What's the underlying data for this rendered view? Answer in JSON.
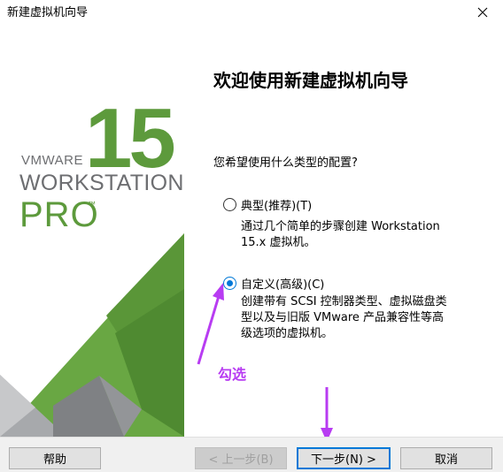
{
  "window": {
    "title": "新建虚拟机向导"
  },
  "logo": {
    "number": "15",
    "brand": "VMWARE",
    "product": "WORKSTATION",
    "edition": "PRO",
    "trademark": "™"
  },
  "main": {
    "heading": "欢迎使用新建虚拟机向导",
    "question": "您希望使用什么类型的配置?",
    "options": [
      {
        "label": "典型(推荐)(T)",
        "description_lines": [
          "通过几个简单的步骤创建 Workstation",
          "15.x 虚拟机。"
        ],
        "selected": false
      },
      {
        "label": "自定义(高级)(C)",
        "description_lines": [
          "创建带有 SCSI 控制器类型、虚拟磁盘类",
          "型以及与旧版 VMware 产品兼容性等高",
          "级选项的虚拟机。"
        ],
        "selected": true
      }
    ]
  },
  "annotation": {
    "text": "勾选",
    "color": "#b83cf2"
  },
  "buttons": {
    "help": "帮助",
    "back": "< 上一步(B)",
    "next": "下一步(N) >",
    "cancel": "取消"
  },
  "colors": {
    "accent": "#0078d7",
    "brand_green": "#5d9a3c",
    "brand_gray": "#6d6e71"
  }
}
